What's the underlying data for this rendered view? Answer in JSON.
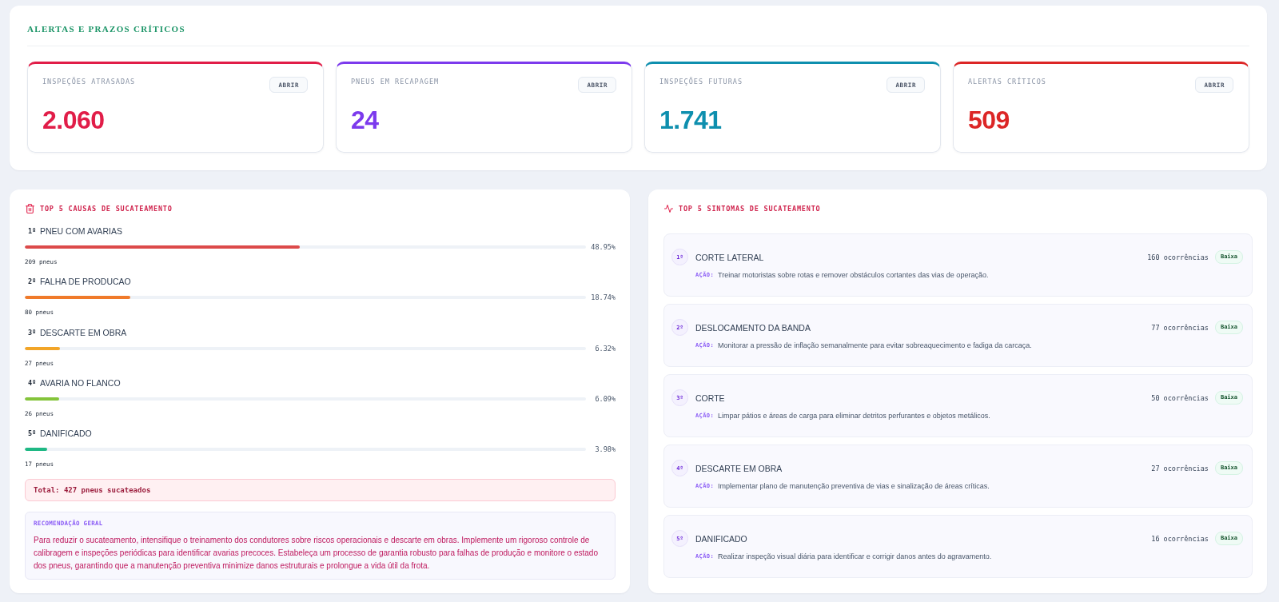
{
  "alerts": {
    "title": "ALERTAS E PRAZOS CRÍTICOS",
    "cards": [
      {
        "label": "INSPEÇÕES ATRASADAS",
        "button": "ABRIR",
        "value": "2.060",
        "color": "#e11d48"
      },
      {
        "label": "PNEUS EM RECAPAGEM",
        "button": "ABRIR",
        "value": "24",
        "color": "#7c3aed"
      },
      {
        "label": "INSPEÇÕES FUTURAS",
        "button": "ABRIR",
        "value": "1.741",
        "color": "#0e8fae"
      },
      {
        "label": "ALERTAS CRÍTICOS",
        "button": "ABRIR",
        "value": "509",
        "color": "#dc2626"
      }
    ]
  },
  "causes": {
    "title": "TOP 5 CAUSAS DE SUCATEAMENTO",
    "items": [
      {
        "rank": "1º",
        "name": "PNEU COM AVARIAS",
        "level": 0.4895,
        "percent": "48.95%",
        "count": "209 pneus",
        "color": "#dc4a4a"
      },
      {
        "rank": "2º",
        "name": "FALHA DE PRODUCAO",
        "level": 0.1874,
        "percent": "18.74%",
        "count": "80 pneus",
        "color": "#f07a2a"
      },
      {
        "rank": "3º",
        "name": "DESCARTE EM OBRA",
        "level": 0.0632,
        "percent": "6.32%",
        "count": "27 pneus",
        "color": "#f2a528"
      },
      {
        "rank": "4º",
        "name": "AVARIA NO FLANCO",
        "level": 0.0609,
        "percent": "6.09%",
        "count": "26 pneus",
        "color": "#84c43a"
      },
      {
        "rank": "5º",
        "name": "DANIFICADO",
        "level": 0.0398,
        "percent": "3.98%",
        "count": "17 pneus",
        "color": "#1fb884"
      }
    ],
    "total": "Total: 427 pneus sucateados",
    "recommendation": {
      "label": "RECOMENDAÇÃO GERAL",
      "text": "Para reduzir o sucateamento, intensifique o treinamento dos condutores sobre riscos operacionais e descarte em obras. Implemente um rigoroso controle de calibragem e inspeções periódicas para identificar avarias precoces. Estabeleça um processo de garantia robusto para falhas de produção e monitore o estado dos pneus, garantindo que a manutenção preventiva minimize danos estruturais e prolongue a vida útil da frota."
    }
  },
  "symptoms": {
    "title": "TOP 5 SINTOMAS DE SUCATEAMENTO",
    "items": [
      {
        "rank": "1º",
        "name": "CORTE LATERAL",
        "count": "160 ocorrências",
        "severity": "Baixa",
        "action_label": "AÇÃO:",
        "action": "Treinar motoristas sobre rotas e remover obstáculos cortantes das vias de operação."
      },
      {
        "rank": "2º",
        "name": "DESLOCAMENTO DA BANDA",
        "count": "77 ocorrências",
        "severity": "Baixa",
        "action_label": "AÇÃO:",
        "action": "Monitorar a pressão de inflação semanalmente para evitar sobreaquecimento e fadiga da carcaça."
      },
      {
        "rank": "3º",
        "name": "CORTE",
        "count": "50 ocorrências",
        "severity": "Baixa",
        "action_label": "AÇÃO:",
        "action": "Limpar pátios e áreas de carga para eliminar detritos perfurantes e objetos metálicos."
      },
      {
        "rank": "4º",
        "name": "DESCARTE EM OBRA",
        "count": "27 ocorrências",
        "severity": "Baixa",
        "action_label": "AÇÃO:",
        "action": "Implementar plano de manutenção preventiva de vias e sinalização de áreas críticas."
      },
      {
        "rank": "5º",
        "name": "DANIFICADO",
        "count": "16 ocorrências",
        "severity": "Baixa",
        "action_label": "AÇÃO:",
        "action": "Realizar inspeção visual diária para identificar e corrigir danos antes do agravamento."
      }
    ]
  }
}
